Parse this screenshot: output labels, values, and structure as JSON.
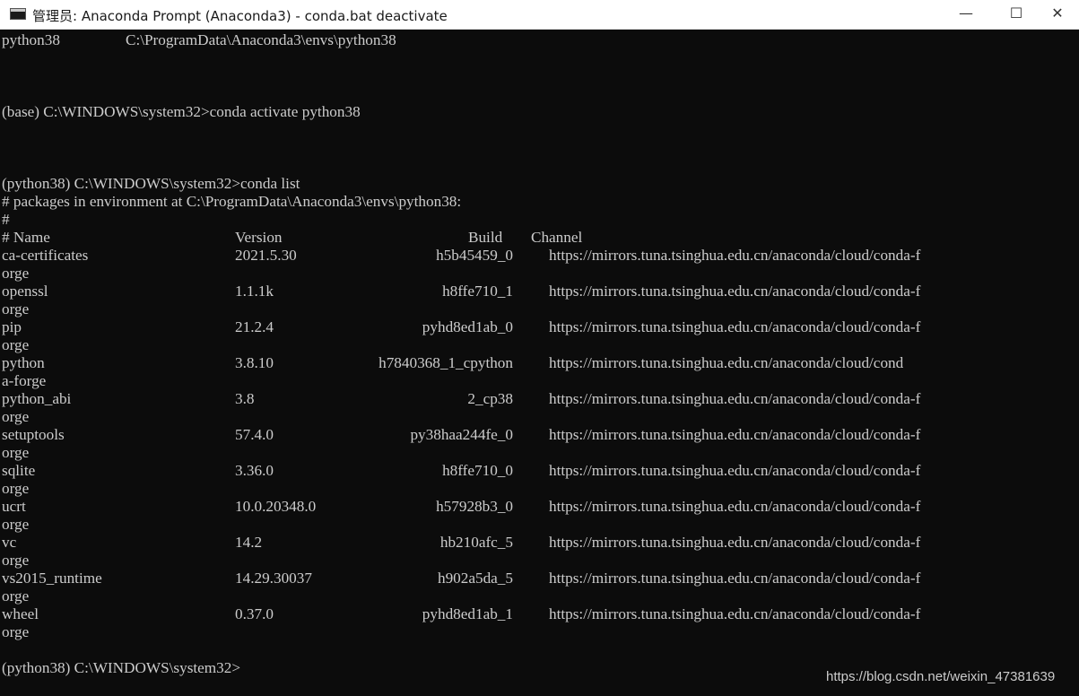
{
  "window": {
    "title": "管理员: Anaconda Prompt (Anaconda3) - conda.bat  deactivate",
    "minimize_glyph": "—",
    "maximize_glyph": "☐",
    "close_glyph": "✕"
  },
  "console": {
    "env_line": "python38                 C:\\ProgramData\\Anaconda3\\envs\\python38",
    "activate_cmd": "(base) C:\\WINDOWS\\system32>conda activate python38",
    "list_cmd": "(python38) C:\\WINDOWS\\system32>conda list",
    "packages_header": "# packages in environment at C:\\ProgramData\\Anaconda3\\envs\\python38:",
    "hash_line": "#",
    "columns": {
      "name": "# Name",
      "version": "Version",
      "build": "Build",
      "channel": "Channel"
    },
    "packages": [
      {
        "name": "ca-certificates",
        "version": "2021.5.30",
        "build": "h5b45459_0",
        "channel": "https://mirrors.tuna.tsinghua.edu.cn/anaconda/cloud/conda-f",
        "wrap": "orge"
      },
      {
        "name": "openssl",
        "version": "1.1.1k",
        "build": "h8ffe710_1",
        "channel": "https://mirrors.tuna.tsinghua.edu.cn/anaconda/cloud/conda-f",
        "wrap": "orge"
      },
      {
        "name": "pip",
        "version": "21.2.4",
        "build": "pyhd8ed1ab_0",
        "channel": "https://mirrors.tuna.tsinghua.edu.cn/anaconda/cloud/conda-f",
        "wrap": "orge"
      },
      {
        "name": "python",
        "version": "3.8.10",
        "build": "h7840368_1_cpython",
        "channel": "https://mirrors.tuna.tsinghua.edu.cn/anaconda/cloud/cond",
        "wrap": "a-forge"
      },
      {
        "name": "python_abi",
        "version": "3.8",
        "build": "2_cp38",
        "channel": "https://mirrors.tuna.tsinghua.edu.cn/anaconda/cloud/conda-f",
        "wrap": "orge"
      },
      {
        "name": "setuptools",
        "version": "57.4.0",
        "build": "py38haa244fe_0",
        "channel": "https://mirrors.tuna.tsinghua.edu.cn/anaconda/cloud/conda-f",
        "wrap": "orge"
      },
      {
        "name": "sqlite",
        "version": "3.36.0",
        "build": "h8ffe710_0",
        "channel": "https://mirrors.tuna.tsinghua.edu.cn/anaconda/cloud/conda-f",
        "wrap": "orge"
      },
      {
        "name": "ucrt",
        "version": "10.0.20348.0",
        "build": "h57928b3_0",
        "channel": "https://mirrors.tuna.tsinghua.edu.cn/anaconda/cloud/conda-f",
        "wrap": "orge"
      },
      {
        "name": "vc",
        "version": "14.2",
        "build": "hb210afc_5",
        "channel": "https://mirrors.tuna.tsinghua.edu.cn/anaconda/cloud/conda-f",
        "wrap": "orge"
      },
      {
        "name": "vs2015_runtime",
        "version": "14.29.30037",
        "build": "h902a5da_5",
        "channel": "https://mirrors.tuna.tsinghua.edu.cn/anaconda/cloud/conda-f",
        "wrap": "orge"
      },
      {
        "name": "wheel",
        "version": "0.37.0",
        "build": "pyhd8ed1ab_1",
        "channel": "https://mirrors.tuna.tsinghua.edu.cn/anaconda/cloud/conda-f",
        "wrap": "orge"
      }
    ],
    "final_prompt": "(python38) C:\\WINDOWS\\system32>"
  },
  "watermark": "https://blog.csdn.net/weixin_47381639"
}
